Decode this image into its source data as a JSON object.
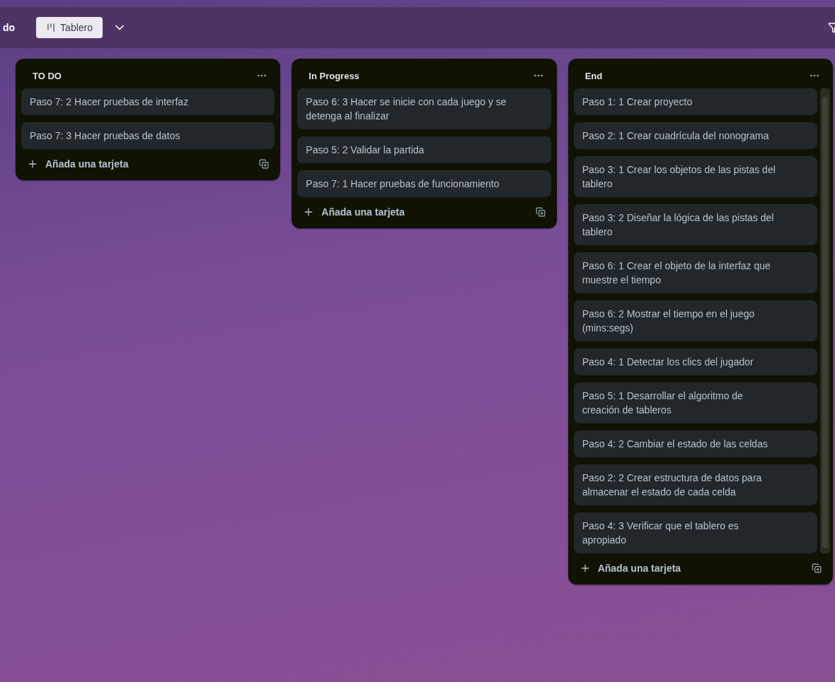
{
  "header": {
    "cut_label": "do",
    "view_tab": {
      "label": "Tablero",
      "selected": true
    }
  },
  "lists": [
    {
      "title": "TO DO",
      "cards": [
        "Paso 7: 2 Hacer pruebas de interfaz",
        "Paso 7: 3 Hacer pruebas de datos"
      ],
      "add_label": "Añada una tarjeta"
    },
    {
      "title": "In Progress",
      "cards": [
        "Paso 6: 3 Hacer se inicie con cada juego y se detenga al finalizar",
        "Paso 5: 2 Validar la partida",
        "Paso 7: 1 Hacer pruebas de funcionamiento"
      ],
      "add_label": "Añada una tarjeta"
    },
    {
      "title": "End",
      "cards": [
        "Paso 1: 1 Crear proyecto",
        "Paso 2: 1 Crear cuadrícula del nonograma",
        "Paso 3: 1 Crear los objetos de las pistas del tablero",
        "Paso 3: 2 Diseñar la lógica de las pistas del tablero",
        "Paso 6: 1 Crear el objeto de la interfaz que muestre el tiempo",
        "Paso 6: 2 Mostrar el tiempo en el juego (mins:segs)",
        "Paso 4: 1 Detectar los clics del jugador",
        "Paso 5: 1 Desarrollar el algoritmo de creación de tableros",
        "Paso 4: 2 Cambiar el estado de las celdas",
        "Paso 2: 2 Crear estructura de datos para almacenar el estado de cada celda",
        "Paso 4: 3 Verificar que el tablero es apropiado"
      ],
      "add_label": "Añada una tarjeta"
    }
  ]
}
